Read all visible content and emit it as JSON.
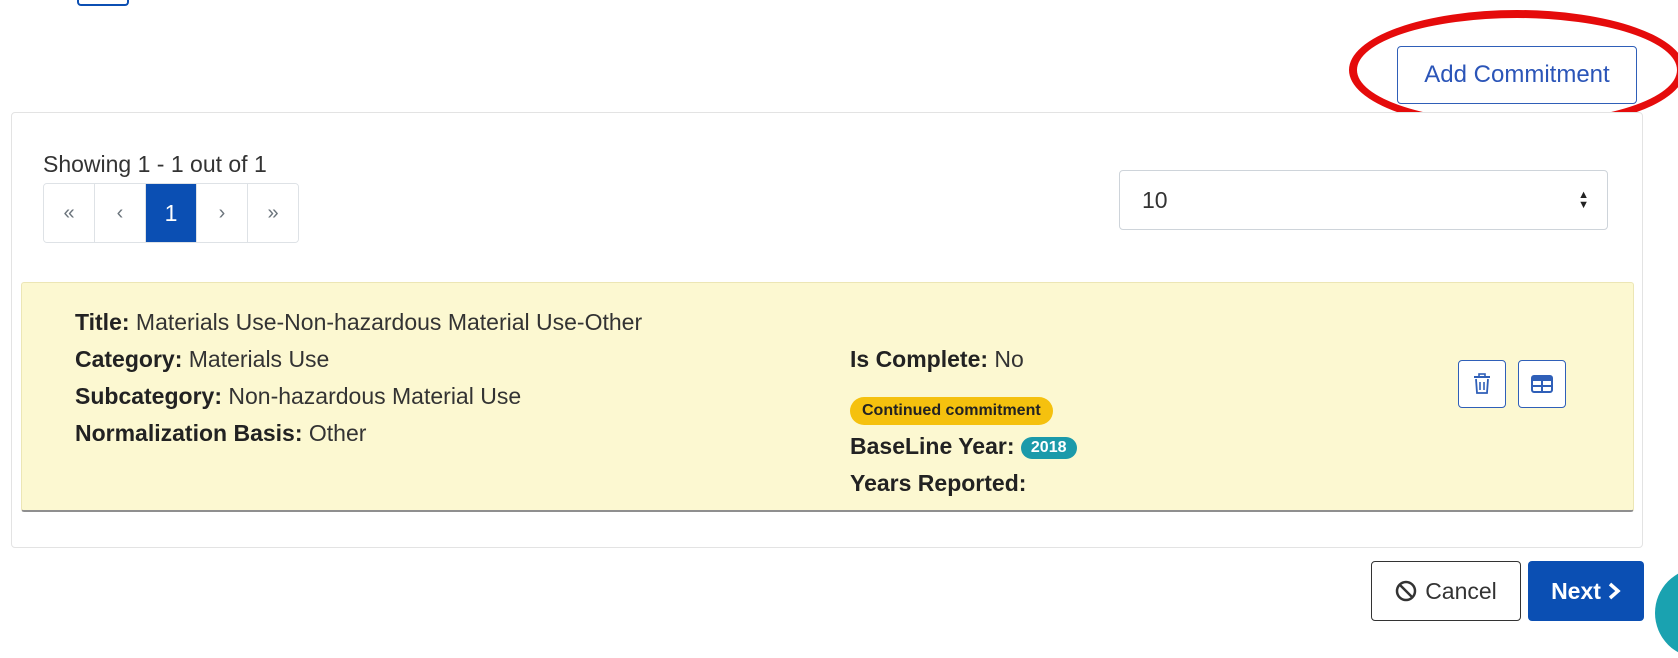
{
  "toolbar": {
    "add_label": "Add Commitment"
  },
  "pagination": {
    "summary": "Showing 1 - 1 out of 1",
    "first": "«",
    "prev": "‹",
    "current": "1",
    "next": "›",
    "last": "»"
  },
  "page_size": {
    "value": "10",
    "icon": "sort-arrows-icon"
  },
  "commitment": {
    "title_label": "Title:",
    "title_value": "Materials Use-Non-hazardous Material Use-Other",
    "category_label": "Category:",
    "category_value": "Materials Use",
    "subcategory_label": "Subcategory:",
    "subcategory_value": "Non-hazardous Material Use",
    "normalization_label": "Normalization Basis:",
    "normalization_value": "Other",
    "complete_label": "Is Complete:",
    "complete_value": "No",
    "status_badge": "Continued commitment",
    "baseline_label": "BaseLine Year:",
    "baseline_value": "2018",
    "years_label": "Years Reported:",
    "years_value": "",
    "delete_icon": "trash-icon",
    "table_icon": "table-icon"
  },
  "footer": {
    "cancel_label": "Cancel",
    "cancel_icon": "ban-icon",
    "next_label": "Next",
    "next_icon": "chevron-right-icon"
  },
  "colors": {
    "primary": "#0b4fb3",
    "card_bg": "#fcf8d1",
    "badge_yellow": "#f5c10e",
    "badge_teal": "#1b9aaa",
    "highlight": "#e50b0b"
  }
}
